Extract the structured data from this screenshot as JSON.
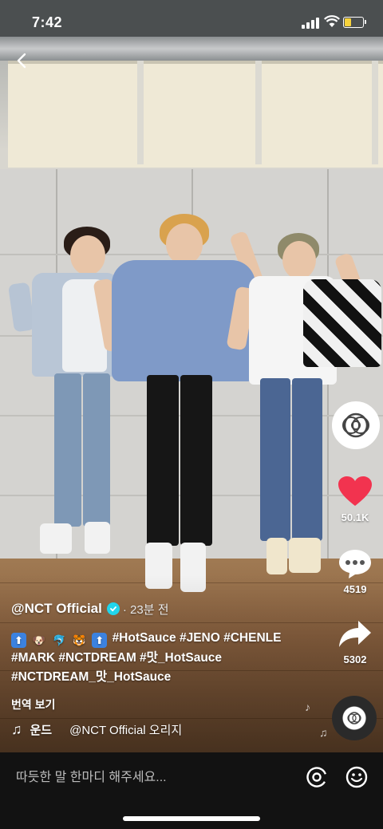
{
  "status_bar": {
    "time": "7:42"
  },
  "video": {
    "description_icon": "dance-video-three-performers"
  },
  "rail": {
    "avatar_icon": "nct-logo-icon",
    "like_count": "50.1K",
    "comment_count": "4519",
    "share_count": "5302"
  },
  "caption": {
    "author": "@NCT Official",
    "time_ago": "· 23분 전",
    "tags_line1": "#HotSauce #JENO #CHENLE",
    "tags_line2": "#MARK #NCTDREAM #맛_HotSauce",
    "tags_line3": "#NCTDREAM_맛_HotSauce",
    "emojis": [
      "⬆",
      "🐶",
      "🐬",
      "🐯",
      "⬆"
    ]
  },
  "translate_label": "번역 보기",
  "music": {
    "prefix": "운드",
    "track": "@NCT Official 오리지"
  },
  "comment_bar": {
    "placeholder": "따듯한 말 한마디 해주세요..."
  },
  "colors": {
    "like": "#f2334f",
    "verified": "#20d5ec",
    "battery": "#f7d33c"
  }
}
